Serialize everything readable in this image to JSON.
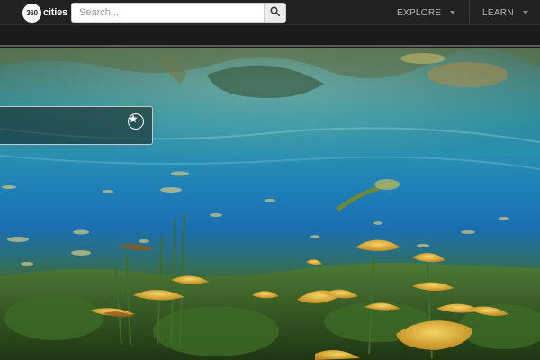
{
  "header": {
    "logo": {
      "badge_text": "360",
      "word": "cities"
    },
    "search": {
      "placeholder": "Search...",
      "value": "",
      "button_icon": "search-icon"
    },
    "nav": [
      {
        "label": "EXPLORE",
        "icon": "chevron-down-icon"
      },
      {
        "label": "LEARN",
        "icon": "chevron-down-icon"
      }
    ]
  },
  "viewer": {
    "panel": {
      "icon": "star-icon"
    }
  },
  "colors": {
    "topbar": "#222222",
    "nav_text": "#b9b9b9",
    "water_deep": "#1b6fb0",
    "lily_yellow": "#e6b33a"
  }
}
